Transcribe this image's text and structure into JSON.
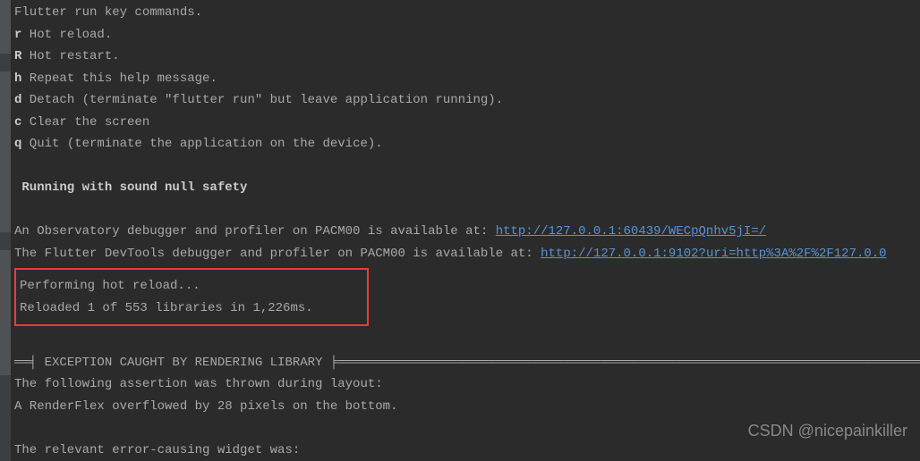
{
  "header": "Flutter run key commands.",
  "commands": [
    {
      "key": "r",
      "desc": " Hot reload."
    },
    {
      "key": "R",
      "desc": " Hot restart."
    },
    {
      "key": "h",
      "desc": " Repeat this help message."
    },
    {
      "key": "d",
      "desc": " Detach (terminate \"flutter run\" but leave application running)."
    },
    {
      "key": "c",
      "desc": " Clear the screen"
    },
    {
      "key": "q",
      "desc": " Quit (terminate the application on the device)."
    }
  ],
  "nullSafety": " Running with sound null safety ",
  "obs": {
    "prefix": "An Observatory debugger and profiler on PACM00 is available at: ",
    "url": "http://127.0.0.1:60439/WECpQnhv5jI=/"
  },
  "devtools": {
    "prefix": "The Flutter DevTools debugger and profiler on PACM00 is available at: ",
    "url": "http://127.0.0.1:9102?uri=http%3A%2F%2F127.0.0"
  },
  "reload": {
    "l1": "Performing hot reload...",
    "l2": "Reloaded 1 of 553 libraries in 1,226ms."
  },
  "exception": {
    "divLeft": "══╡ ",
    "title": "EXCEPTION CAUGHT BY RENDERING LIBRARY",
    "divRight": " ╞═══════════════════════════════════════════════════════════════════════════════",
    "l1": "The following assertion was thrown during layout:",
    "l2": "A RenderFlex overflowed by 28 pixels on the bottom.",
    "l3": "The relevant error-causing widget was:"
  },
  "watermark": "CSDN @nicepainkiller"
}
